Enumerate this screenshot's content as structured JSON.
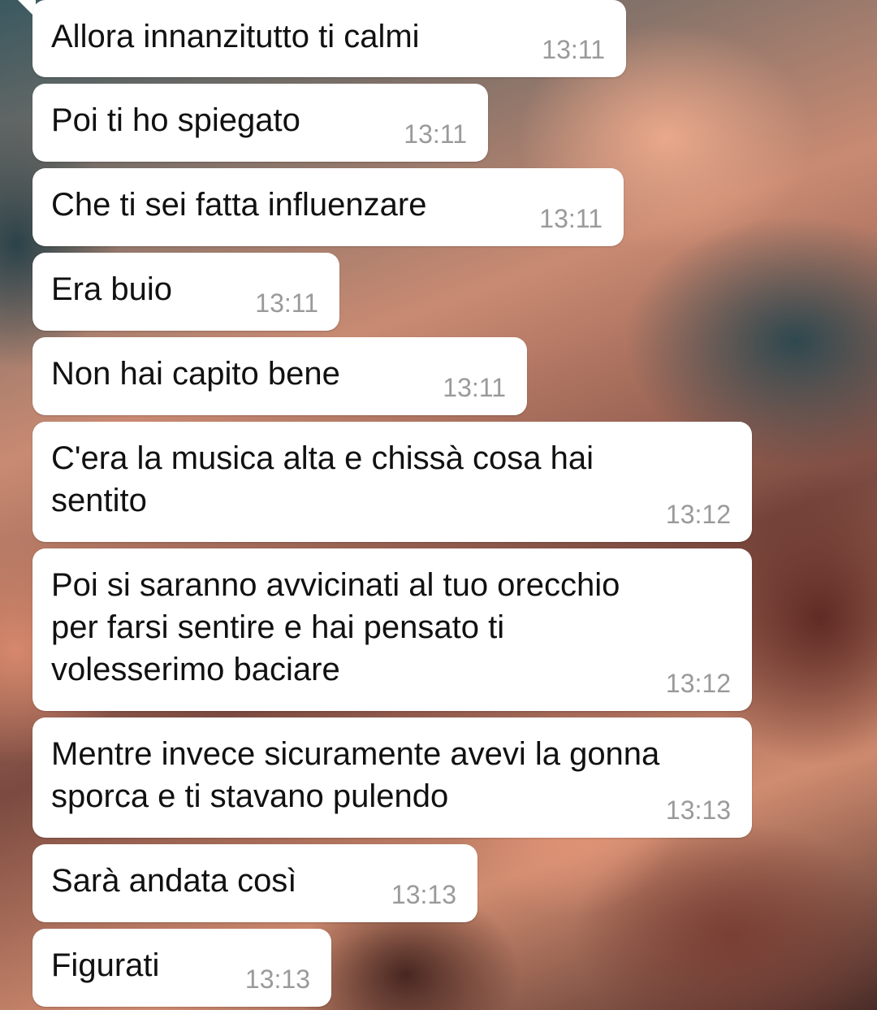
{
  "messages": [
    {
      "text": "Allora innanzitutto ti calmi",
      "time": "13:11"
    },
    {
      "text": "Poi ti ho spiegato",
      "time": "13:11"
    },
    {
      "text": "Che ti sei fatta influenzare",
      "time": "13:11"
    },
    {
      "text": "Era buio",
      "time": "13:11"
    },
    {
      "text": "Non hai capito bene",
      "time": "13:11"
    },
    {
      "text": "C'era la musica alta e chissà cosa hai\nsentito",
      "time": "13:12"
    },
    {
      "text": "Poi si saranno avvicinati al tuo orecchio\nper farsi sentire e hai pensato ti\nvolesserimo baciare",
      "time": "13:12"
    },
    {
      "text": "Mentre invece sicuramente avevi la gonna\nsporca e ti stavano pulendo",
      "time": "13:13"
    },
    {
      "text": "Sarà andata così",
      "time": "13:13"
    },
    {
      "text": "Figurati",
      "time": "13:13"
    }
  ],
  "colors": {
    "bubble": "#ffffff",
    "text": "#111111",
    "timestamp": "#9a9a9a"
  }
}
